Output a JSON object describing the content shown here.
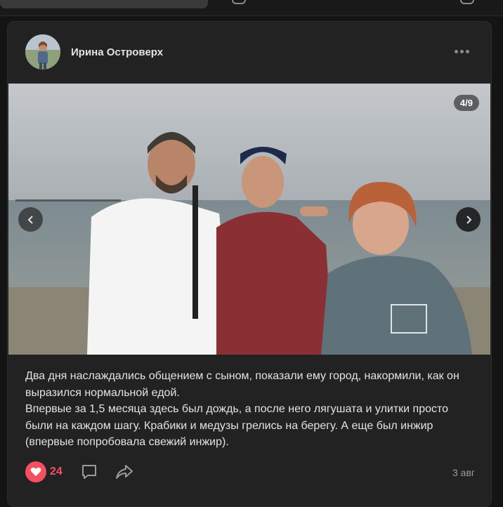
{
  "post": {
    "author": "Ирина Островерх",
    "photo_counter": "4/9",
    "text": "Два дня наслаждались общением с сыном, показали ему город, накормили, как он выразился нормальной едой.\nВпервые за 1,5 месяца здесь был дождь, а после него лягушата и улитки просто были на каждом шагу. Крабики и медузы грелись на берегу. А еще был инжир (впервые попробовала свежий инжир).",
    "likes": "24",
    "date": "3 авг"
  },
  "icons": {
    "more": "more-horizontal-icon",
    "prev": "chevron-left-icon",
    "next": "chevron-right-icon",
    "like": "heart-icon",
    "comment": "comment-icon",
    "share": "share-icon"
  },
  "colors": {
    "background": "#141414",
    "card": "#222222",
    "like_accent": "#f55060",
    "text": "#e1e3e6",
    "muted": "#9a9b9d"
  }
}
